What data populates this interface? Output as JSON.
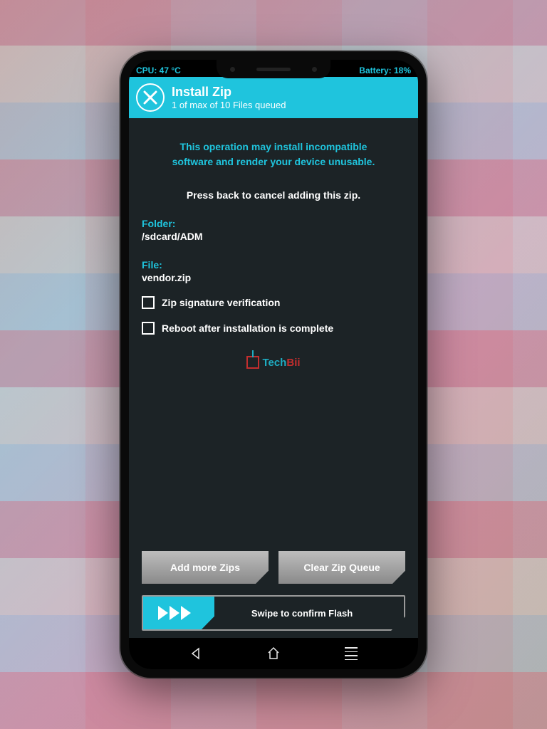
{
  "status": {
    "cpu": "CPU: 47 °C",
    "battery": "Battery: 18%"
  },
  "header": {
    "title": "Install Zip",
    "subtitle": "1 of max of 10 Files queued"
  },
  "warning": {
    "line1": "This operation may install incompatible",
    "line2": "software and render your device unusable."
  },
  "instruction": "Press back to cancel adding this zip.",
  "folder": {
    "label": "Folder:",
    "value": "/sdcard/ADM"
  },
  "file": {
    "label": "File:",
    "value": "vendor.zip"
  },
  "checkboxes": {
    "zip_sig": "Zip signature verification",
    "reboot": "Reboot after installation is complete"
  },
  "watermark": {
    "tech": "Tech",
    "bii": "Bii"
  },
  "buttons": {
    "add_more": "Add more Zips",
    "clear_queue": "Clear Zip Queue"
  },
  "swipe": {
    "label": "Swipe to confirm Flash"
  }
}
